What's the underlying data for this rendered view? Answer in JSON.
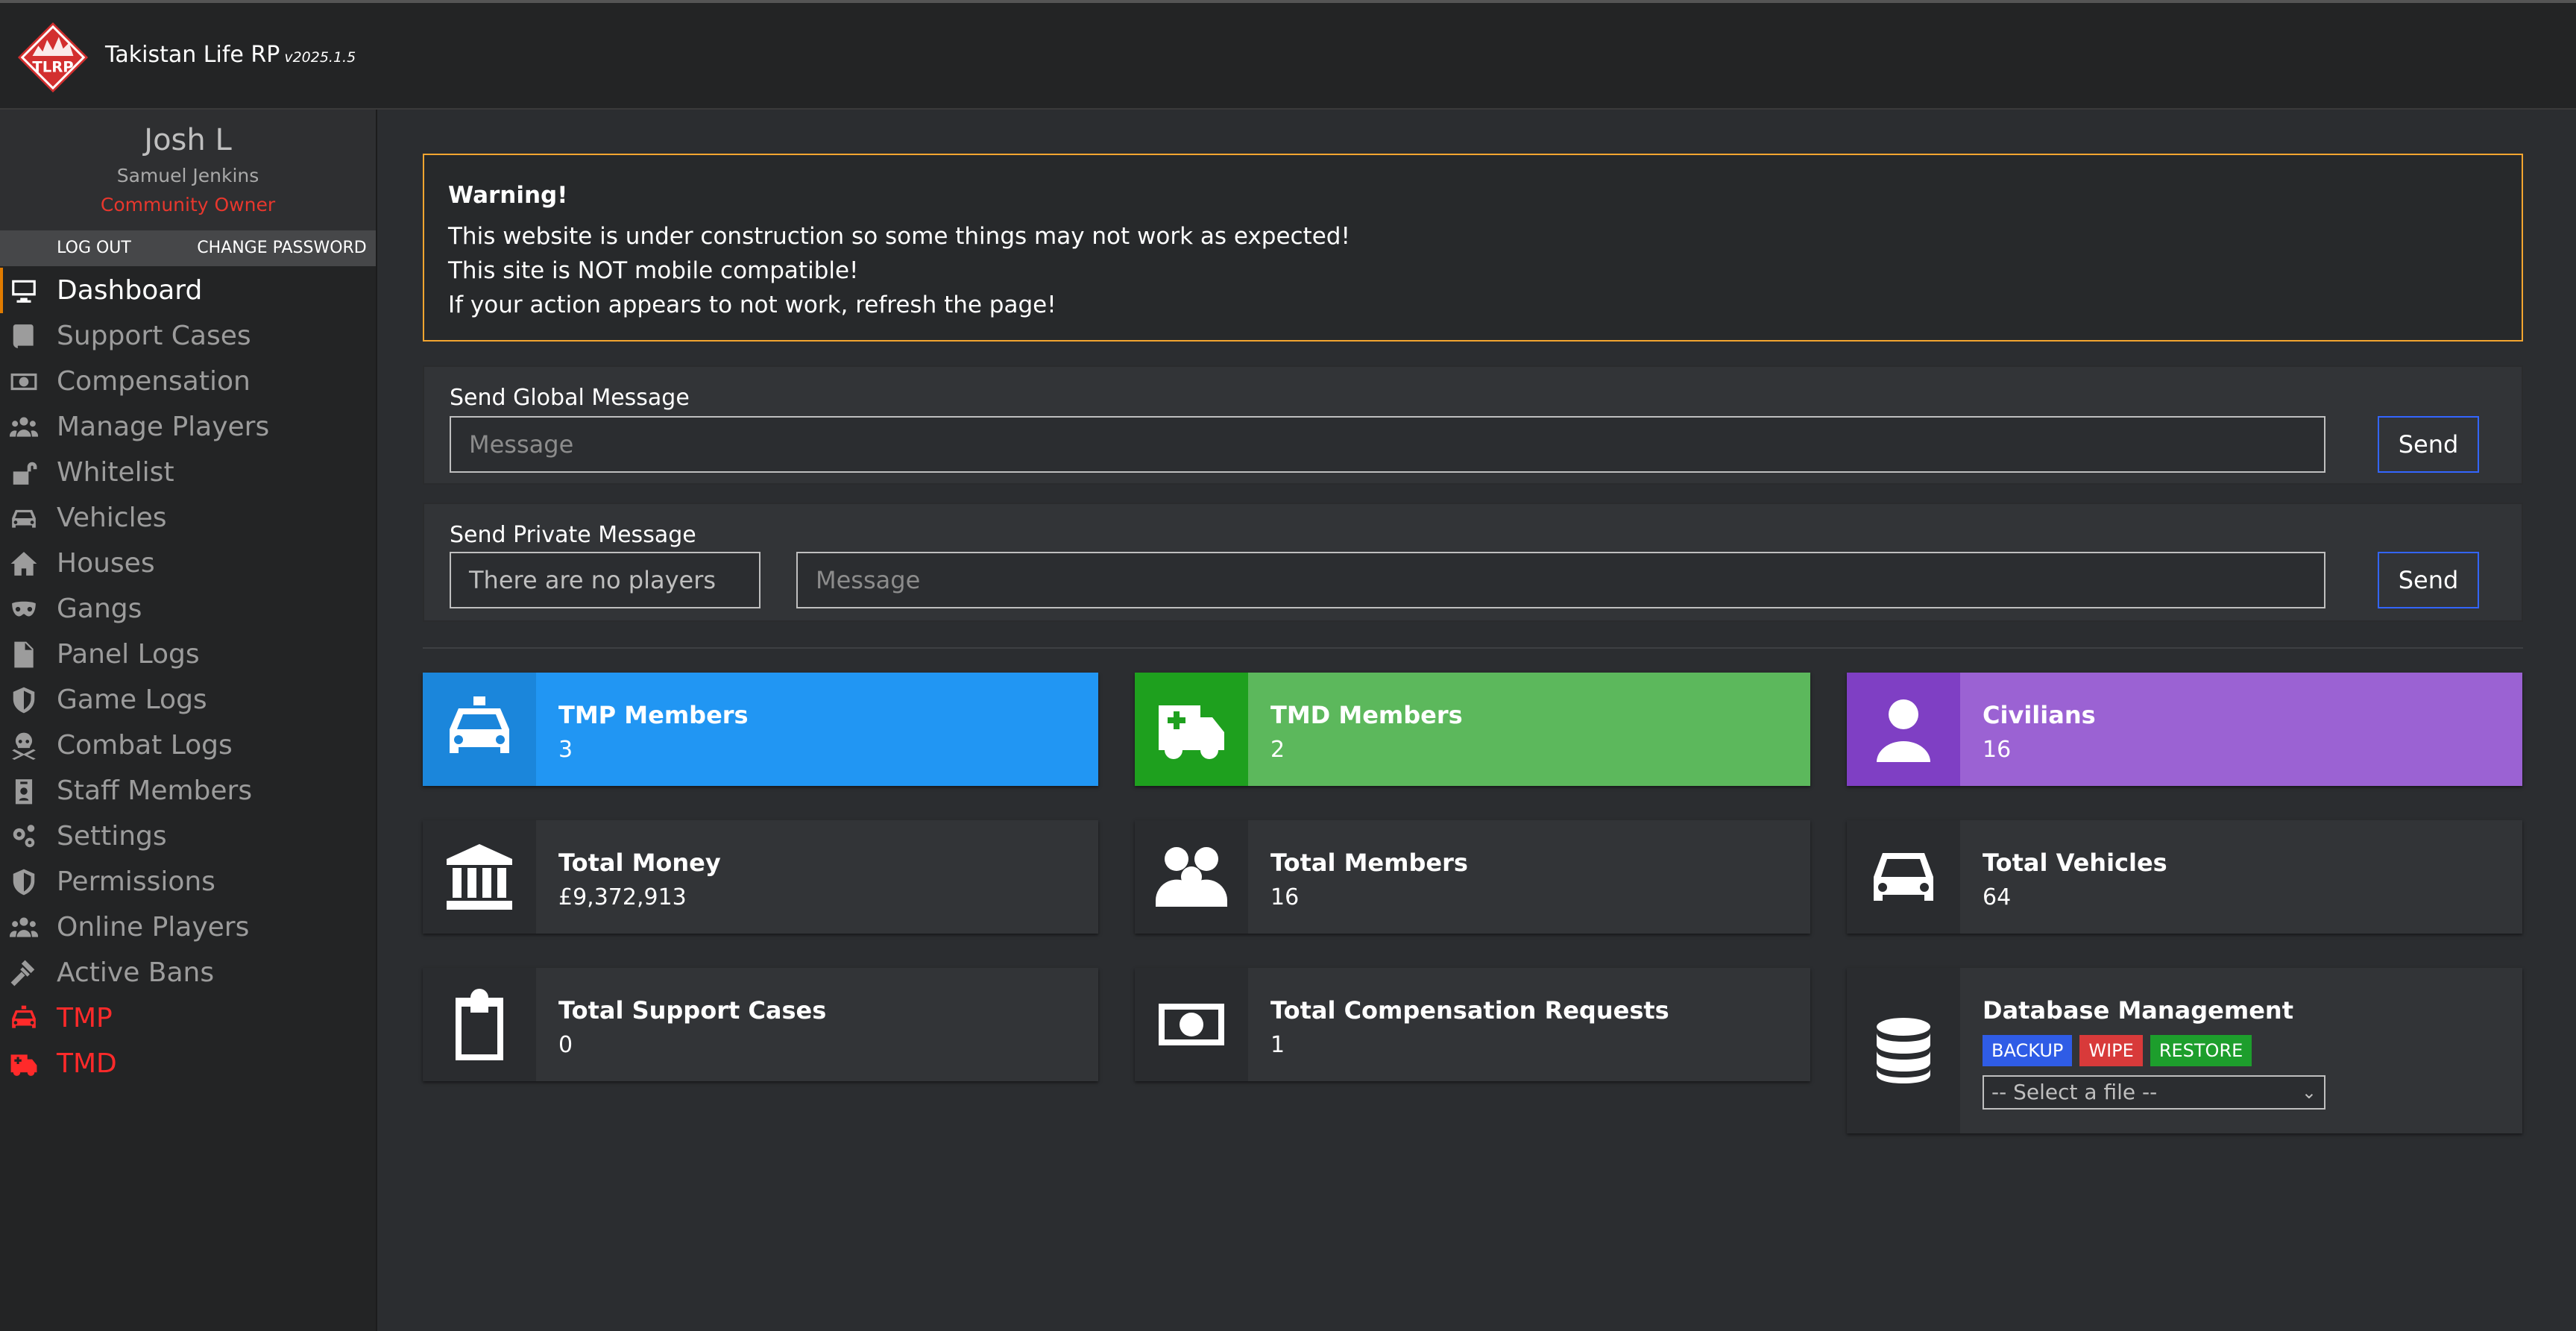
{
  "header": {
    "app_name": "Takistan Life RP",
    "version": "v2025.1.5",
    "logo_text": "TLRP"
  },
  "profile": {
    "name": "Josh L",
    "character": "Samuel Jenkins",
    "role": "Community Owner"
  },
  "actions": {
    "logout": "LOG OUT",
    "change_password": "CHANGE PASSWORD"
  },
  "nav": [
    {
      "label": "Dashboard",
      "icon": "monitor-icon"
    },
    {
      "label": "Support Cases",
      "icon": "book-icon"
    },
    {
      "label": "Compensation",
      "icon": "money-bill-icon"
    },
    {
      "label": "Manage Players",
      "icon": "users-icon"
    },
    {
      "label": "Whitelist",
      "icon": "unlock-icon"
    },
    {
      "label": "Vehicles",
      "icon": "car-icon"
    },
    {
      "label": "Houses",
      "icon": "house-icon"
    },
    {
      "label": "Gangs",
      "icon": "mask-icon"
    },
    {
      "label": "Panel Logs",
      "icon": "file-icon"
    },
    {
      "label": "Game Logs",
      "icon": "shield-icon"
    },
    {
      "label": "Combat Logs",
      "icon": "skull-crossbones-icon"
    },
    {
      "label": "Staff Members",
      "icon": "id-badge-icon"
    },
    {
      "label": "Settings",
      "icon": "gears-icon"
    },
    {
      "label": "Permissions",
      "icon": "shield-icon"
    },
    {
      "label": "Online Players",
      "icon": "users-icon"
    },
    {
      "label": "Active Bans",
      "icon": "gavel-icon"
    },
    {
      "label": "TMP",
      "icon": "police-car-icon"
    },
    {
      "label": "TMD",
      "icon": "ambulance-icon"
    }
  ],
  "warning": {
    "title": "Warning!",
    "lines": [
      "This website is under construction so some things may not work as expected!",
      "This site is NOT mobile compatible!",
      "If your action appears to not work, refresh the page!"
    ]
  },
  "global_message": {
    "label": "Send Global Message",
    "placeholder": "Message",
    "button": "Send"
  },
  "private_message": {
    "label": "Send Private Message",
    "player_select": "There are no players",
    "placeholder": "Message",
    "button": "Send"
  },
  "stats": {
    "tmp": {
      "title": "TMP Members",
      "value": "3",
      "color": "#2196f3"
    },
    "tmd": {
      "title": "TMD Members",
      "value": "2",
      "color": "#5cb85c"
    },
    "civ": {
      "title": "Civilians",
      "value": "16",
      "color": "#9b62d3"
    },
    "money": {
      "title": "Total Money",
      "value": "£9,372,913"
    },
    "members": {
      "title": "Total Members",
      "value": "16"
    },
    "vehicles": {
      "title": "Total Vehicles",
      "value": "64"
    },
    "support": {
      "title": "Total Support Cases",
      "value": "0"
    },
    "comp": {
      "title": "Total Compensation Requests",
      "value": "1"
    }
  },
  "database": {
    "title": "Database Management",
    "backup": "BACKUP",
    "wipe": "WIPE",
    "restore": "RESTORE",
    "select_placeholder": "-- Select a file --"
  }
}
